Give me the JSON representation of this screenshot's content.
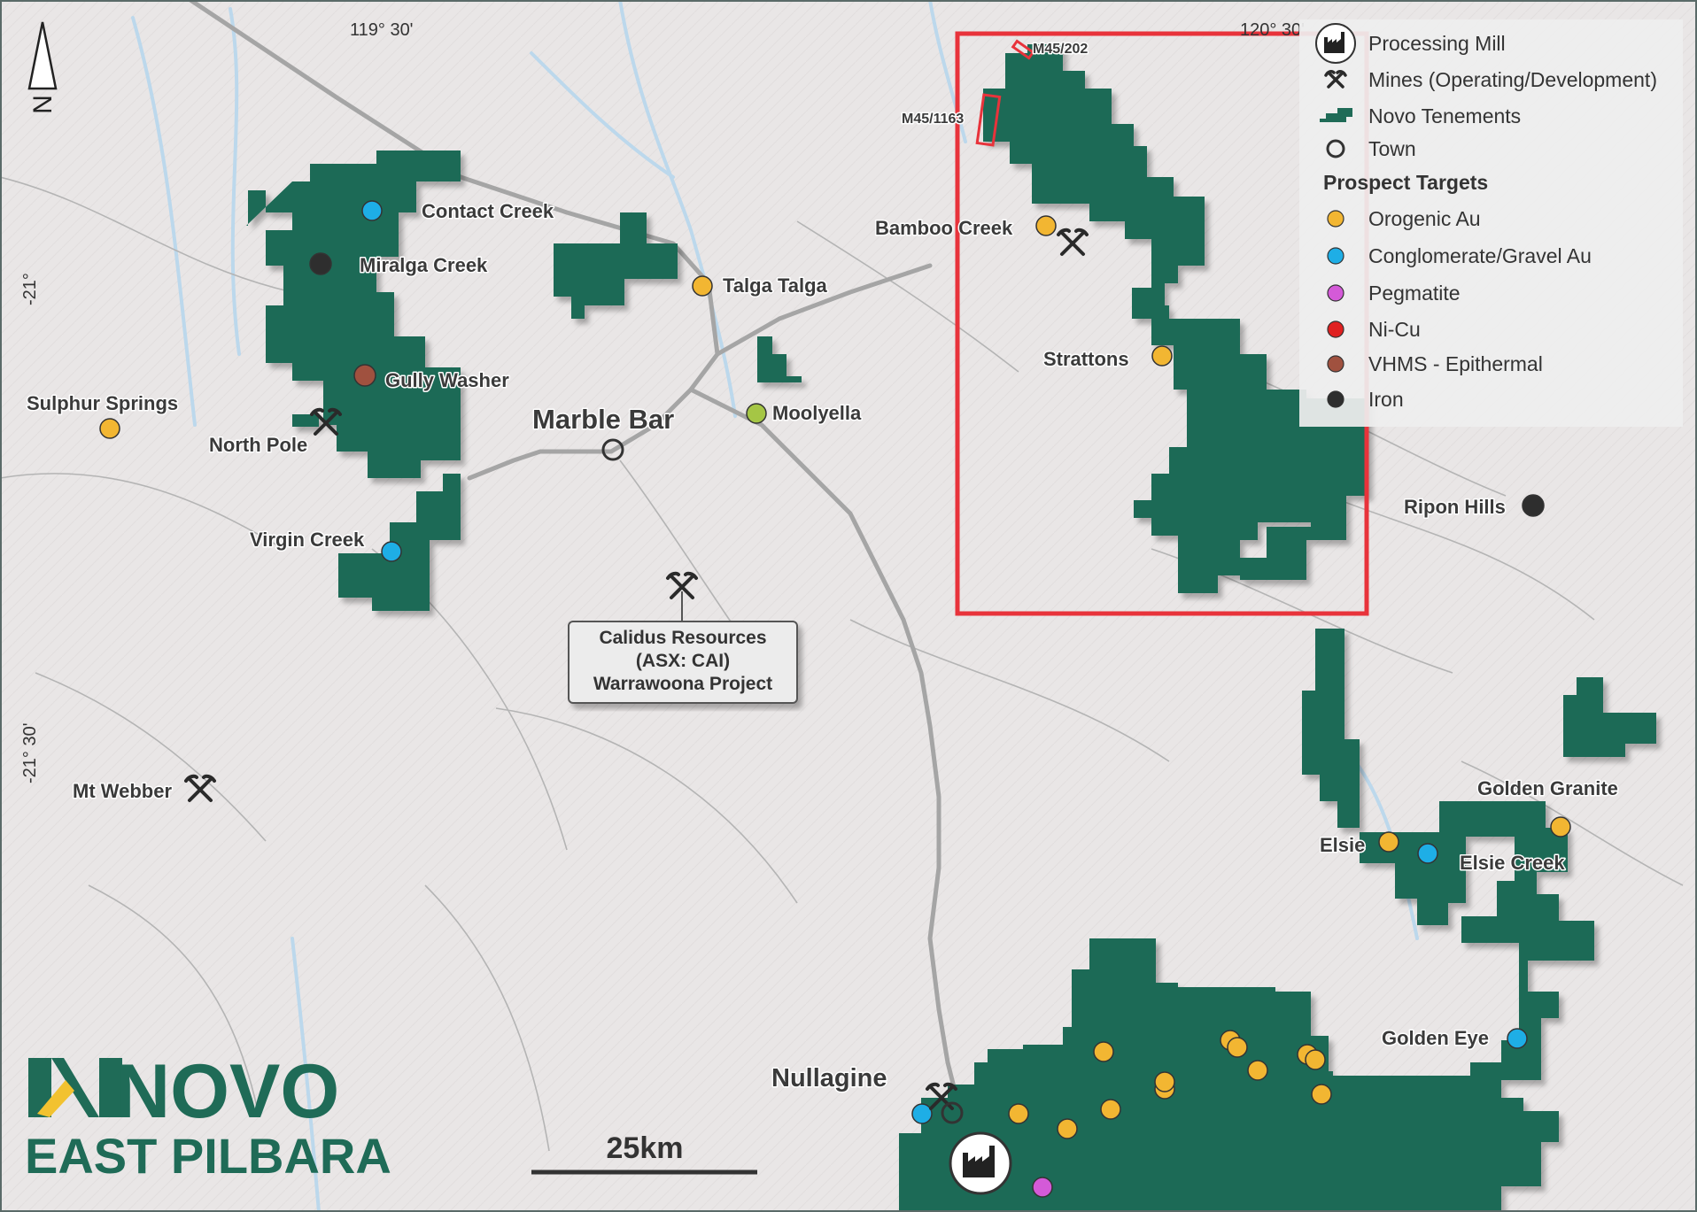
{
  "colors": {
    "tenement": "#1f6b57",
    "orogenic_au": "#f2b632",
    "conglomerate_au": "#1eaee6",
    "pegmatite": "#d45ad8",
    "ni_cu": "#e02020",
    "vhms": "#a0513f",
    "iron": "#2e2e2e",
    "moolyella": "#a5c645",
    "outline_box": "#e8333b",
    "road": "#a5a5a5",
    "river": "#bcd8ec",
    "terrain": "#e9e6e6"
  },
  "grid_labels": {
    "lon_left": "119° 30'",
    "lon_right": "120° 30'",
    "lat_upper": "-21°",
    "lat_lower": "-21° 30'"
  },
  "north_arrow": {
    "letter": "N",
    "icon": "north-arrow-icon"
  },
  "legend": {
    "items": [
      {
        "icon": "processing-mill-icon",
        "label": "Processing Mill"
      },
      {
        "icon": "mine-icon",
        "label": "Mines (Operating/Development)"
      },
      {
        "icon": "tenement-icon",
        "label": "Novo Tenements"
      },
      {
        "icon": "town-icon",
        "label": "Town"
      }
    ],
    "prospect_heading": "Prospect Targets",
    "prospects": [
      {
        "label": "Orogenic Au",
        "color": "#f2b632"
      },
      {
        "label": "Conglomerate/Gravel Au",
        "color": "#1eaee6"
      },
      {
        "label": "Pegmatite",
        "color": "#d45ad8"
      },
      {
        "label": "Ni-Cu",
        "color": "#e02020"
      },
      {
        "label": "VHMS - Epithermal",
        "color": "#a0513f"
      },
      {
        "label": "Iron",
        "color": "#2e2e2e"
      }
    ]
  },
  "labels": {
    "contact_creek": "Contact Creek",
    "miralga_creek": "Miralga Creek",
    "gully_washer": "Gully Washer",
    "north_pole": "North Pole",
    "sulphur_springs": "Sulphur Springs",
    "virgin_creek": "Virgin Creek",
    "talga_talga": "Talga Talga",
    "marble_bar": "Marble Bar",
    "moolyella": "Moolyella",
    "bamboo_creek": "Bamboo Creek",
    "strattons": "Strattons",
    "ripon_hills": "Ripon Hills",
    "mt_webber": "Mt Webber",
    "m45_202": "M45/202",
    "m45_1163": "M45/1163",
    "golden_granite": "Golden Granite",
    "elsie": "Elsie",
    "elsie_creek": "Elsie Creek",
    "golden_eye": "Golden Eye",
    "nullagine": "Nullagine"
  },
  "calidus_box": {
    "line1": "Calidus Resources",
    "line2": "(ASX: CAI)",
    "line3": "Warrawoona Project"
  },
  "scale_bar": {
    "label": "25km"
  },
  "brand": {
    "logo_text": "NOVO",
    "subtitle": "EAST PILBARA"
  }
}
